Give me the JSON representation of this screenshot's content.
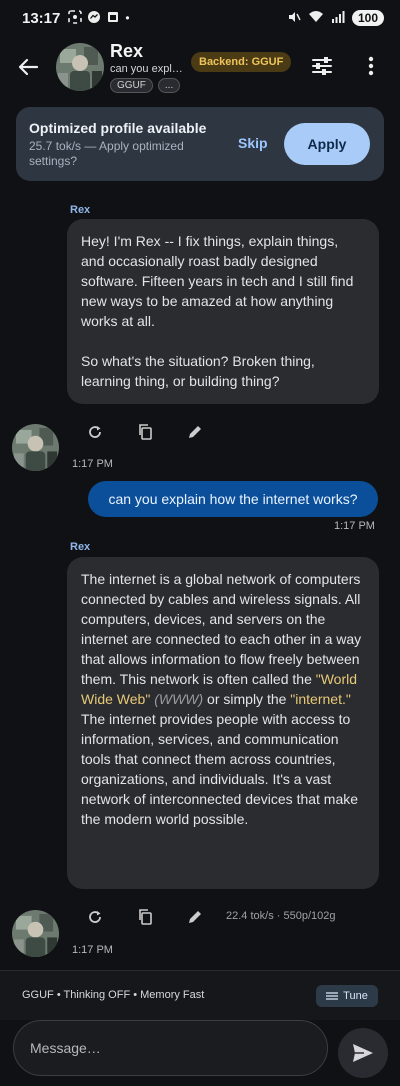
{
  "statusbar": {
    "time": "13:17",
    "battery": "100",
    "left_icons": [
      "screenshot-icon",
      "messenger-icon",
      "app-icon",
      "dot-icon"
    ],
    "right_icons": [
      "mute-icon",
      "wifi-icon",
      "signal-icon"
    ]
  },
  "header": {
    "title": "Rex",
    "subtitle": "can you explain how the internet works?",
    "chips": [
      "GGUF",
      "..."
    ],
    "backend_badge": "Backend: GGUF"
  },
  "banner": {
    "title": "Optimized profile available",
    "subtitle": "25.7 tok/s — Apply optimized settings?",
    "skip_label": "Skip",
    "apply_label": "Apply"
  },
  "messages": [
    {
      "role": "assistant",
      "sender": "Rex",
      "paragraphs": [
        "Hey! I'm Rex -- I fix things, explain things, and occasionally roast badly designed software. Fifteen years in tech and I still find new ways to be amazed at how anything works at all.",
        "So what's the situation? Broken thing, learning thing, or building thing?"
      ],
      "time": "1:17 PM"
    },
    {
      "role": "user",
      "text": "can you explain how the internet works?",
      "time": "1:17 PM"
    },
    {
      "role": "assistant",
      "sender": "Rex",
      "seg1": "The internet is a global network of computers connected by cables and wireless signals. All computers, devices, and servers on the internet are connected to each other in a way that allows information to flow freely between them. This network is often called the ",
      "hl1": "\"World Wide Web\"",
      "seg2": " ",
      "em1": "(WWW)",
      "seg3": " or simply the ",
      "hl2": "\"internet.\"",
      "seg4": " The internet provides people with access to information, services, and communication tools that connect them across countries, organizations, and individuals. It's a vast network of interconnected devices that make the modern world possible.",
      "time": "1:17 PM",
      "stats": "22.4 tok/s · 550p/102g"
    }
  ],
  "config": {
    "text": "GGUF • Thinking OFF • Memory Fast",
    "tune_label": "Tune"
  },
  "composer": {
    "placeholder": "Message…"
  },
  "colors": {
    "background": "#101114",
    "bubble_assistant": "#2b2c30",
    "bubble_user": "#0b4f9a",
    "accent": "#a8cbf7",
    "badge": "#f0c45c",
    "highlight": "#e7c977"
  }
}
